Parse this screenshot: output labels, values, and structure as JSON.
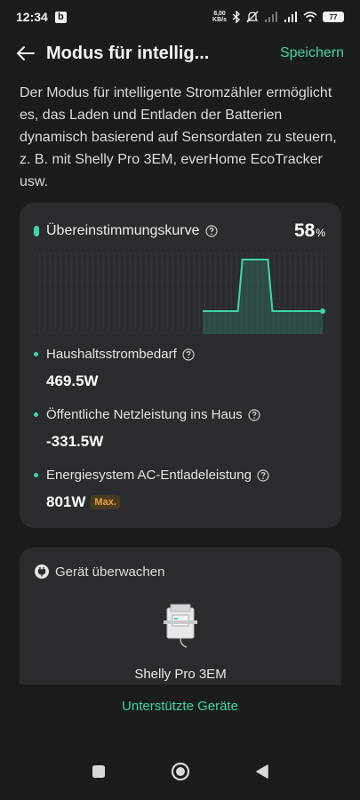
{
  "status_bar": {
    "time": "12:34",
    "notification_letter": "b",
    "net_speed_value": "8,00",
    "net_speed_unit": "KB/s",
    "battery_level": "77"
  },
  "header": {
    "title": "Modus für intellig...",
    "save_label": "Speichern"
  },
  "description": "Der Modus für intelligente Stromzähler ermöglicht es, das Laden und Entladen der Batterien dynamisch basierend auf Sensordaten zu steuern, z. B. mit Shelly Pro 3EM, everHome EcoTracker usw.",
  "curve_card": {
    "label": "Übereinstimmungskurve",
    "percent_value": "58",
    "percent_unit": "%",
    "curve_levels": [
      0.0,
      0.0,
      0.0,
      1.0,
      1.0,
      0.0,
      0.0,
      0.0,
      0.0
    ]
  },
  "metrics": [
    {
      "label": "Haushaltsstrombedarf",
      "value": "469.5W"
    },
    {
      "label": "Öffentliche Netzleistung ins Haus",
      "value": "-331.5W"
    },
    {
      "label": "Energiesystem AC-Entladeleistung",
      "value": "801W",
      "badge": "Max."
    }
  ],
  "device_card": {
    "header": "Gerät überwachen",
    "device_name": "Shelly Pro 3EM"
  },
  "supported_devices_label": "Unterstützte Geräte",
  "colors": {
    "accent": "#3ed6a9",
    "background": "#1b1c1e",
    "card": "#2a2c2f",
    "badge_text": "#e9a336"
  },
  "icons": {
    "back": "arrow-left-icon",
    "help": "question-circle-icon",
    "monitor": "power-plug-icon",
    "nav_recent": "square-icon",
    "nav_home": "circle-icon",
    "nav_back": "triangle-left-icon"
  }
}
